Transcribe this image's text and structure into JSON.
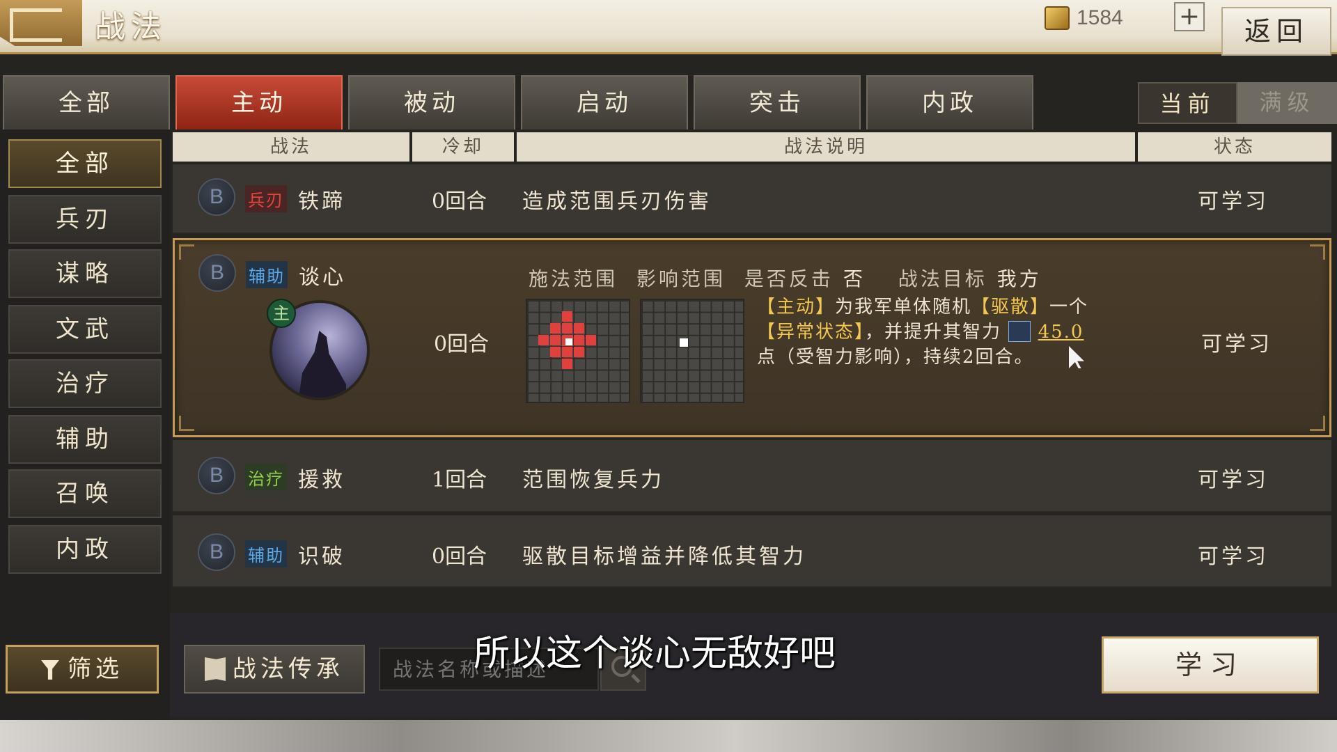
{
  "header": {
    "title": "战法",
    "currency_value": "1584",
    "plus_label": "+",
    "return_label": "返回"
  },
  "top_tabs": [
    {
      "label": "全部"
    },
    {
      "label": "主动",
      "active": true
    },
    {
      "label": "被动"
    },
    {
      "label": "启动"
    },
    {
      "label": "突击"
    },
    {
      "label": "内政"
    }
  ],
  "level_toggle": {
    "current": "当前",
    "max": "满级"
  },
  "sidebar": {
    "items": [
      {
        "label": "全部",
        "active": true
      },
      {
        "label": "兵刃"
      },
      {
        "label": "谋略"
      },
      {
        "label": "文武"
      },
      {
        "label": "治疗"
      },
      {
        "label": "辅助"
      },
      {
        "label": "召唤"
      },
      {
        "label": "内政"
      }
    ],
    "filter_label": "筛选"
  },
  "table": {
    "headers": {
      "name": "战法",
      "cooldown": "冷却",
      "desc": "战法说明",
      "status": "状态"
    },
    "rows": [
      {
        "grade": "B",
        "type": "兵刃",
        "name": "铁蹄",
        "cooldown": "0回合",
        "desc": "造成范围兵刃伤害",
        "status": "可学习"
      },
      {
        "grade": "B",
        "type": "辅助",
        "name": "谈心",
        "cooldown": "0回合",
        "status": "可学习",
        "badge": "主",
        "cast_range_label": "施法范围",
        "effect_range_label": "影响范围",
        "counter_label": "是否反击",
        "counter_value": "否",
        "target_label": "战法目标",
        "target_value": "我方",
        "detail": {
          "p1": "【主动】",
          "p2": "为我军单体随机",
          "p3": "【驱散】",
          "p4": "一个",
          "p5": "【异常状态】",
          "p6": "，并提升其智力",
          "p7": "45.0",
          "p8": "点（受智力影响），持续2回合。"
        }
      },
      {
        "grade": "B",
        "type": "治疗",
        "name": "援救",
        "cooldown": "1回合",
        "desc": "范围恢复兵力",
        "status": "可学习"
      },
      {
        "grade": "B",
        "type": "辅助",
        "name": "识破",
        "cooldown": "0回合",
        "desc": "驱散目标增益并降低其智力",
        "status": "可学习"
      }
    ]
  },
  "bottom": {
    "inherit_label": "战法传承",
    "search_placeholder": "战法名称或描述",
    "learn_label": "学习"
  },
  "subtitle": "所以这个谈心无敌好吧",
  "colors": {
    "accent_gold": "#c59a52",
    "active_tab_red": "#b8382a",
    "highlight_yellow": "#f4c84f"
  }
}
